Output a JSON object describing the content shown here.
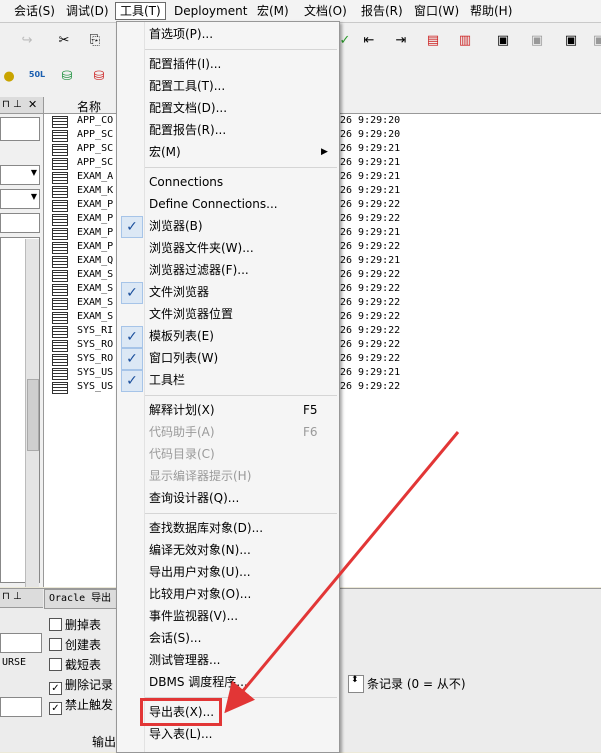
{
  "menubar": {
    "items": [
      "会话(S)",
      "调试(D)",
      "工具(T)",
      "Deployment",
      "宏(M)",
      "文档(O)",
      "报告(R)",
      "窗口(W)",
      "帮助(H)"
    ]
  },
  "tools_menu": {
    "items": [
      {
        "label": "首选项(P)..."
      },
      {
        "label": "配置插件(I)..."
      },
      {
        "label": "配置工具(T)..."
      },
      {
        "label": "配置文档(D)..."
      },
      {
        "label": "配置报告(R)..."
      },
      {
        "label": "宏(M)"
      },
      {
        "label": "Connections"
      },
      {
        "label": "Define Connections..."
      },
      {
        "label": "浏览器(B)"
      },
      {
        "label": "浏览器文件夹(W)..."
      },
      {
        "label": "浏览器过滤器(F)..."
      },
      {
        "label": "文件浏览器"
      },
      {
        "label": "文件浏览器位置"
      },
      {
        "label": "模板列表(E)"
      },
      {
        "label": "窗口列表(W)"
      },
      {
        "label": "工具栏"
      },
      {
        "label": "解释计划(X)",
        "shortcut": "F5"
      },
      {
        "label": "代码助手(A)",
        "shortcut": "F6"
      },
      {
        "label": "代码目录(C)"
      },
      {
        "label": "显示编译器提示(H)"
      },
      {
        "label": "查询设计器(Q)..."
      },
      {
        "label": "查找数据库对象(D)..."
      },
      {
        "label": "编译无效对象(N)..."
      },
      {
        "label": "导出用户对象(U)..."
      },
      {
        "label": "比较用户对象(O)..."
      },
      {
        "label": "事件监视器(V)..."
      },
      {
        "label": "会话(S)..."
      },
      {
        "label": "测试管理器..."
      },
      {
        "label": "DBMS 调度程序..."
      },
      {
        "label": "导出表(X)..."
      },
      {
        "label": "导入表(L)..."
      }
    ]
  },
  "grid": {
    "header_name": "名称",
    "rows": [
      {
        "name": "APP_CO",
        "time": "26 9:29:20"
      },
      {
        "name": "APP_SC",
        "time": "26 9:29:20"
      },
      {
        "name": "APP_SC",
        "time": "26 9:29:21"
      },
      {
        "name": "APP_SC",
        "time": "26 9:29:21"
      },
      {
        "name": "EXAM_A",
        "time": "26 9:29:21"
      },
      {
        "name": "EXAM_K",
        "time": "26 9:29:21"
      },
      {
        "name": "EXAM_P",
        "time": "26 9:29:22"
      },
      {
        "name": "EXAM_P",
        "time": "26 9:29:22"
      },
      {
        "name": "EXAM_P",
        "time": "26 9:29:21"
      },
      {
        "name": "EXAM_P",
        "time": "26 9:29:22"
      },
      {
        "name": "EXAM_Q",
        "time": "26 9:29:21"
      },
      {
        "name": "EXAM_S",
        "time": "26 9:29:22"
      },
      {
        "name": "EXAM_S",
        "time": "26 9:29:22"
      },
      {
        "name": "EXAM_S",
        "time": "26 9:29:22"
      },
      {
        "name": "EXAM_S",
        "time": "26 9:29:22"
      },
      {
        "name": "SYS_RI",
        "time": "26 9:29:22"
      },
      {
        "name": "SYS_RO",
        "time": "26 9:29:22"
      },
      {
        "name": "SYS_RO",
        "time": "26 9:29:22"
      },
      {
        "name": "SYS_US",
        "time": "26 9:29:21"
      },
      {
        "name": "SYS_US",
        "time": "26 9:29:22"
      }
    ]
  },
  "bottom": {
    "tab_label": "Oracle 导出",
    "checkboxes": [
      "删掉表",
      "创建表",
      "截短表",
      "删除记录",
      "禁止触发"
    ],
    "left_label": "URSE",
    "record_label": "条记录 (0 = 从不)",
    "output_label": "输出"
  },
  "toolbar": {
    "label_50l": "50L"
  }
}
